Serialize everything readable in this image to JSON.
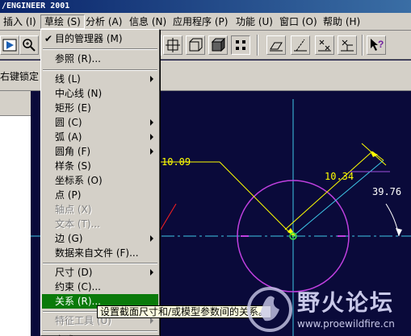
{
  "title": "/ENGINEER 2001",
  "menubar": {
    "items": [
      "插入 (I)",
      "草绘 (S)",
      "分析 (A)",
      "信息 (N)",
      "应用程序 (P)",
      "功能 (U)",
      "窗口 (O)",
      "帮助 (H)"
    ],
    "active": "草绘 (S)"
  },
  "toolbar2": {
    "label": "右键锁定"
  },
  "sketch_menu": {
    "items": [
      {
        "label": "目的管理器 (M)",
        "checked": true
      },
      {
        "label": "参照 (R)..."
      },
      {
        "label": "线 (L)",
        "submenu": true
      },
      {
        "label": "中心线 (N)"
      },
      {
        "label": "矩形 (E)"
      },
      {
        "label": "圆 (C)",
        "submenu": true
      },
      {
        "label": "弧 (A)",
        "submenu": true
      },
      {
        "label": "圆角 (F)",
        "submenu": true
      },
      {
        "label": "样条 (S)"
      },
      {
        "label": "坐标系 (O)"
      },
      {
        "label": "点 (P)"
      },
      {
        "label": "轴点 (X)",
        "disabled": true
      },
      {
        "label": "文本 (T)...",
        "disabled": true
      },
      {
        "label": "边 (G)",
        "submenu": true
      },
      {
        "label": "数据来自文件 (F)..."
      },
      {
        "label": "尺寸 (D)",
        "submenu": true
      },
      {
        "label": "约束 (C)..."
      },
      {
        "label": "关系 (R)...",
        "highlight": true
      },
      {
        "label": "特征工具 (U)",
        "disabled": true,
        "submenu": true
      },
      {
        "label": "完成"
      }
    ]
  },
  "tooltip": "设置截面尺寸和/或模型参数间的关系。",
  "dimensions": {
    "d1": "10.09",
    "d2": "10.34",
    "d3": "39.76"
  },
  "watermark": {
    "title": "野火论坛",
    "url": "www.proewildfire.cn"
  },
  "colors": {
    "background": "#0a0a3a",
    "dimension": "#ffff00",
    "centerline": "#3ec8e8",
    "circle": "#c040e0",
    "highlight": "#0a7a0a"
  }
}
